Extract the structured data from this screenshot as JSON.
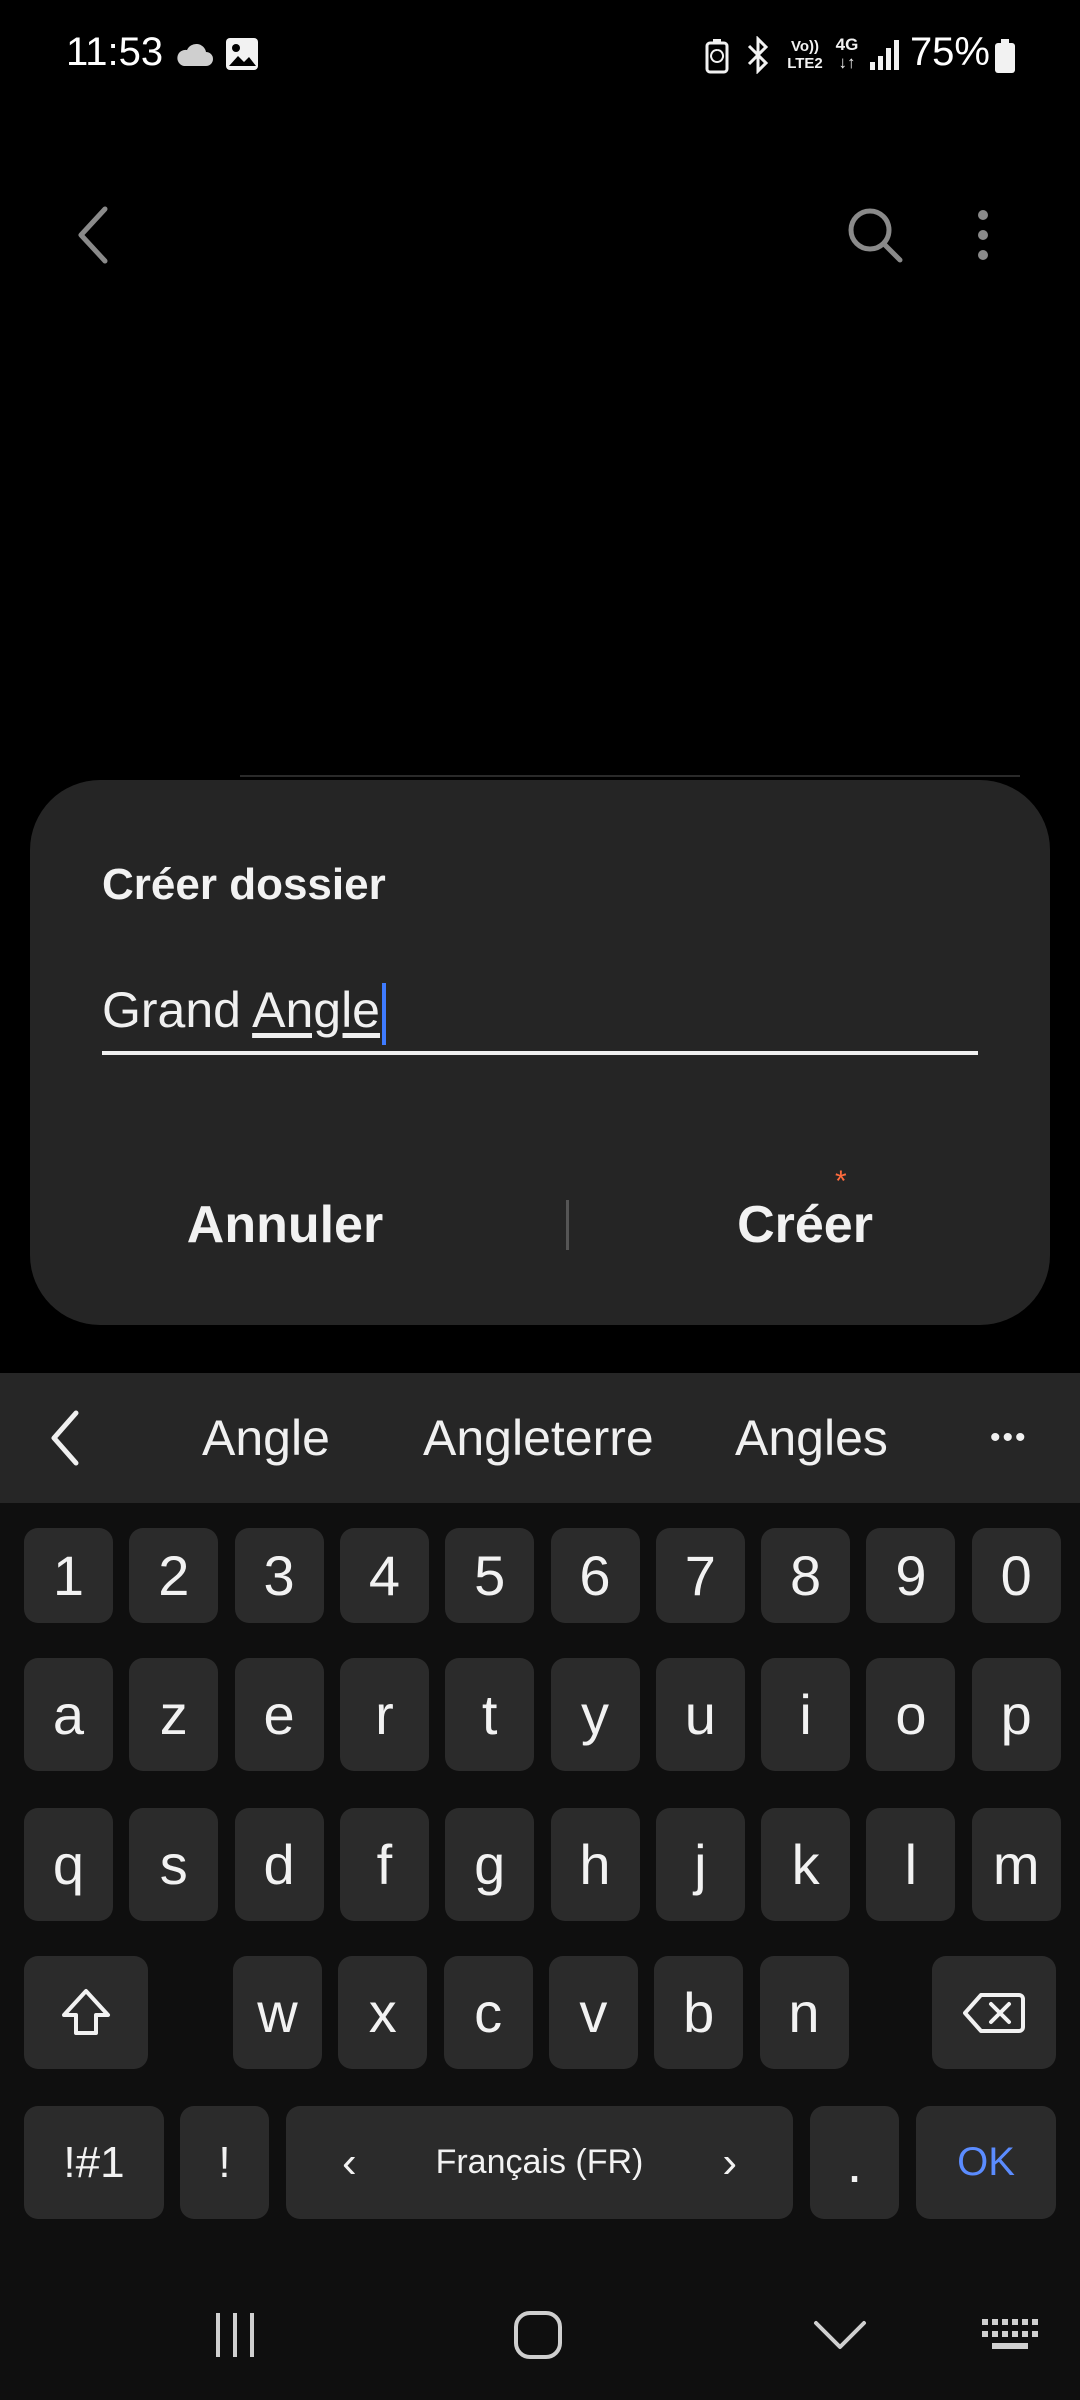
{
  "status_bar": {
    "time": "11:53",
    "battery": "75%"
  },
  "icons": {
    "cloud": "cloud-icon",
    "gallery": "image-icon",
    "battery_saver": "battery-saver-icon",
    "bluetooth": "bluetooth-icon",
    "volte": "volte-icon",
    "network_4g": "4g-icon",
    "signal": "signal-icon",
    "battery": "battery-icon",
    "back": "back-icon",
    "search": "search-icon",
    "more": "more-vertical-icon"
  },
  "status_icon_labels": {
    "volte_top": "Vo))",
    "volte_bottom": "LTE2",
    "network_top": "4G",
    "network_bottom": "↓↑"
  },
  "dialog": {
    "title": "Créer dossier",
    "input_plain": "Grand ",
    "input_underlined": "Angle",
    "cancel": "Annuler",
    "create": "Créer",
    "create_badge": "*"
  },
  "keyboard": {
    "suggestions": [
      "Angle",
      "Angleterre",
      "Angles"
    ],
    "suggestion_more": "•••",
    "row_numbers": [
      "1",
      "2",
      "3",
      "4",
      "5",
      "6",
      "7",
      "8",
      "9",
      "0"
    ],
    "row1": [
      "a",
      "z",
      "e",
      "r",
      "t",
      "y",
      "u",
      "i",
      "o",
      "p"
    ],
    "row2": [
      "q",
      "s",
      "d",
      "f",
      "g",
      "h",
      "j",
      "k",
      "l",
      "m"
    ],
    "row3": [
      "w",
      "x",
      "c",
      "v",
      "b",
      "n"
    ],
    "symbols": "!#1",
    "exclaim": "!",
    "language": "Français (FR)",
    "period": ".",
    "ok": "OK"
  },
  "colors": {
    "accent_blue": "#5b8cff",
    "badge_orange": "#ff6b3d",
    "dialog_bg": "#252525",
    "key_bg": "#2b2b2b"
  }
}
